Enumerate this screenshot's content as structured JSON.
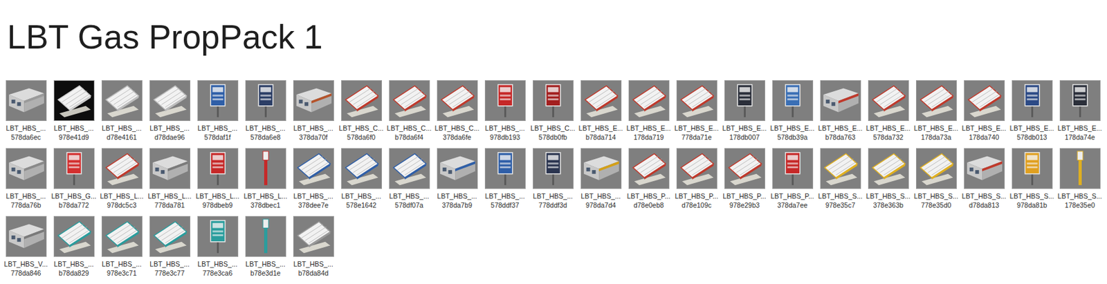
{
  "title": "LBT Gas PropPack 1",
  "rows": [
    [
      {
        "name": "LBT_HBS_...",
        "id": "578da6ec",
        "kind": "building",
        "color": "#9a9a9a"
      },
      {
        "name": "LBT_HBS_...",
        "id": "978e41d9",
        "kind": "canopy-night",
        "color": "#cfcfcf"
      },
      {
        "name": "LBT_HBS_...",
        "id": "d78e4161",
        "kind": "canopy",
        "color": "#bdbdbd"
      },
      {
        "name": "LBT_HBS_...",
        "id": "d78dae96",
        "kind": "canopy",
        "color": "#bdbdbd"
      },
      {
        "name": "LBT_HBS_...",
        "id": "578daf1f",
        "kind": "sign",
        "color": "#2f5fa8"
      },
      {
        "name": "LBT_HBS_...",
        "id": "578da6e8",
        "kind": "sign",
        "color": "#2c3e66"
      },
      {
        "name": "LBT_HBS_...",
        "id": "378da70f",
        "kind": "building",
        "color": "#b5532a"
      },
      {
        "name": "LBT_HBS_C...",
        "id": "578da6f0",
        "kind": "canopy",
        "color": "#c0392b"
      },
      {
        "name": "LBT_HBS_C...",
        "id": "b78da6f4",
        "kind": "canopy",
        "color": "#c0392b"
      },
      {
        "name": "LBT_HBS_C...",
        "id": "378da6fe",
        "kind": "canopy",
        "color": "#c0392b"
      },
      {
        "name": "LBT_HBS_...",
        "id": "978db193",
        "kind": "sign",
        "color": "#c62828"
      },
      {
        "name": "LBT_HBS_C...",
        "id": "578db0fb",
        "kind": "sign",
        "color": "#a31f1f"
      },
      {
        "name": "LBT_HBS_E...",
        "id": "b78da714",
        "kind": "canopy",
        "color": "#c0392b"
      },
      {
        "name": "LBT_HBS_E...",
        "id": "178da719",
        "kind": "canopy",
        "color": "#c0392b"
      },
      {
        "name": "LBT_HBS_E...",
        "id": "778da71e",
        "kind": "canopy",
        "color": "#c0392b"
      },
      {
        "name": "LBT_HBS_E...",
        "id": "178db007",
        "kind": "sign",
        "color": "#2b2f3a"
      },
      {
        "name": "LBT_HBS_E...",
        "id": "578db39a",
        "kind": "sign",
        "color": "#3a6fb5"
      },
      {
        "name": "LBT_HBS_E...",
        "id": "b78da763",
        "kind": "building",
        "color": "#c0392b"
      },
      {
        "name": "LBT_HBS_E...",
        "id": "578da732",
        "kind": "canopy",
        "color": "#c0392b"
      },
      {
        "name": "LBT_HBS_E...",
        "id": "178da73a",
        "kind": "canopy",
        "color": "#c0392b"
      },
      {
        "name": "LBT_HBS_E...",
        "id": "178da740",
        "kind": "canopy",
        "color": "#c0392b"
      },
      {
        "name": "LBT_HBS_E...",
        "id": "578db013",
        "kind": "sign",
        "color": "#2c4a86"
      },
      {
        "name": "LBT_HBS_E...",
        "id": "178da74e",
        "kind": "sign",
        "color": "#2b2f3a"
      }
    ],
    [
      {
        "name": "LBT_HBS_...",
        "id": "778da76b",
        "kind": "building",
        "color": "#8a8a8a"
      },
      {
        "name": "LBT_HBS_G...",
        "id": "b78da772",
        "kind": "sign",
        "color": "#d32f2f"
      },
      {
        "name": "LBT_HBS_L...",
        "id": "978dc5c3",
        "kind": "canopy",
        "color": "#c0392b"
      },
      {
        "name": "LBT_HBS_L...",
        "id": "778da781",
        "kind": "building",
        "color": "#7a7a7a"
      },
      {
        "name": "LBT_HBS_L...",
        "id": "978dbeb9",
        "kind": "sign",
        "color": "#c62828"
      },
      {
        "name": "LBT_HBS_L...",
        "id": "378dbec1",
        "kind": "pole",
        "color": "#c62828"
      },
      {
        "name": "LBT_HBS_...",
        "id": "378dee7e",
        "kind": "canopy",
        "color": "#2f5fa8"
      },
      {
        "name": "LBT_HBS_...",
        "id": "578e1642",
        "kind": "canopy",
        "color": "#2f5fa8"
      },
      {
        "name": "LBT_HBS_...",
        "id": "578df07a",
        "kind": "canopy",
        "color": "#2f5fa8"
      },
      {
        "name": "LBT_HBS_...",
        "id": "378da7b9",
        "kind": "building",
        "color": "#2f5fa8"
      },
      {
        "name": "LBT_HBS_...",
        "id": "578ddf37",
        "kind": "sign",
        "color": "#2f5fa8"
      },
      {
        "name": "LBT_HBS_...",
        "id": "778ddf3d",
        "kind": "sign",
        "color": "#2b3550"
      },
      {
        "name": "LBT_HBS_...",
        "id": "978da7d4",
        "kind": "building",
        "color": "#d4a017"
      },
      {
        "name": "LBT_HBS_P...",
        "id": "d78e0eb8",
        "kind": "canopy",
        "color": "#c0392b"
      },
      {
        "name": "LBT_HBS_P...",
        "id": "d78e109c",
        "kind": "canopy",
        "color": "#c0392b"
      },
      {
        "name": "LBT_HBS_P...",
        "id": "978e29b3",
        "kind": "canopy",
        "color": "#c0392b"
      },
      {
        "name": "LBT_HBS_P...",
        "id": "378da7ee",
        "kind": "sign",
        "color": "#c62828"
      },
      {
        "name": "LBT_HBS_S...",
        "id": "978e35c7",
        "kind": "canopy",
        "color": "#e0b020"
      },
      {
        "name": "LBT_HBS_S...",
        "id": "378e363b",
        "kind": "canopy",
        "color": "#e0b020"
      },
      {
        "name": "LBT_HBS_S...",
        "id": "778e35d0",
        "kind": "canopy",
        "color": "#e0b020"
      },
      {
        "name": "LBT_HBS_S...",
        "id": "d78da813",
        "kind": "building",
        "color": "#c0392b"
      },
      {
        "name": "LBT_HBS_S...",
        "id": "978da81b",
        "kind": "sign",
        "color": "#e0a020"
      },
      {
        "name": "LBT_HBS_S...",
        "id": "178e35e0",
        "kind": "pole",
        "color": "#e0b020"
      }
    ],
    [
      {
        "name": "LBT_HBS_V...",
        "id": "778da846",
        "kind": "building",
        "color": "#7a7a7a"
      },
      {
        "name": "LBT_HBS_...",
        "id": "b78da829",
        "kind": "canopy",
        "color": "#2a9d9d"
      },
      {
        "name": "LBT_HBS_...",
        "id": "978e3c71",
        "kind": "canopy",
        "color": "#2a9d9d"
      },
      {
        "name": "LBT_HBS_...",
        "id": "778e3c77",
        "kind": "canopy",
        "color": "#2a9d9d"
      },
      {
        "name": "LBT_HBS_...",
        "id": "778e3ca6",
        "kind": "sign",
        "color": "#2a9d9d"
      },
      {
        "name": "LBT_HBS_...",
        "id": "b78e3d1e",
        "kind": "pole",
        "color": "#2a9d9d"
      },
      {
        "name": "LBT_HBS_...",
        "id": "b78da84d",
        "kind": "canopy",
        "color": "#9a9a9a"
      }
    ]
  ]
}
